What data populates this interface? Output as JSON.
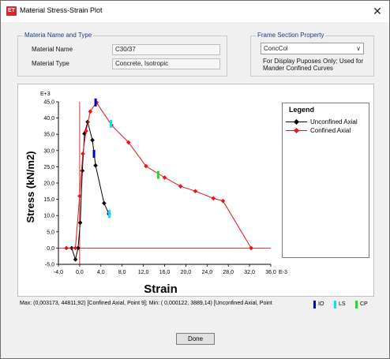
{
  "window": {
    "title": "Material Stress-Strain Plot",
    "icon_text": "ET",
    "close_glyph": "✕"
  },
  "material": {
    "group_title": "Materia Name and Type",
    "name_label": "Material Name",
    "name_value": "C30/37",
    "type_label": "Material Type",
    "type_value": "Concrete, Isotropic"
  },
  "frame_section": {
    "group_title": "Frame Section Property",
    "selected": "ConcCol",
    "note_line1": "For Display Puposes Only;  Used for",
    "note_line2": "Mander Confined Curves"
  },
  "legend": {
    "title": "Legend",
    "items": [
      "Unconfined Axial",
      "Confined Axial"
    ]
  },
  "status": {
    "text": "Max: (0,003173, 44811,92)  [Confined Axial, Point 9];  Min: ( 0,000122,  3889,14)  [Unconfined Axial, Point",
    "keys": [
      {
        "label": "IO",
        "color": "#0000cc"
      },
      {
        "label": "LS",
        "color": "#00e5ff"
      },
      {
        "label": "CP",
        "color": "#22dd22"
      }
    ]
  },
  "done_label": "Done",
  "chart_data": {
    "type": "line",
    "ylabel": "Stress (kN/m2)",
    "xlabel": "Strain",
    "y_multiplier": "E+3",
    "x_multiplier": "E-3",
    "xlim": [
      -4,
      36
    ],
    "ylim": [
      -5,
      45
    ],
    "x_ticks": [
      "-4,0",
      "0,0",
      "4,0",
      "8,0",
      "12,0",
      "16,0",
      "20,0",
      "24,0",
      "28,0",
      "32,0",
      "36,0"
    ],
    "y_ticks": [
      "-5,0",
      "0,0",
      "5,0",
      "10,0",
      "15,0",
      "20,0",
      "25,0",
      "30,0",
      "35,0",
      "40,0",
      "45,0"
    ],
    "colors": {
      "unconfined": "#000000",
      "confined": "#e8141a",
      "axis_vertical": "#cc0000",
      "axis_horizontal": "#cc0000"
    },
    "series": [
      {
        "name": "Unconfined Axial",
        "color": "#000000",
        "points": [
          [
            -1.5,
            0
          ],
          [
            -0.8,
            -3.5
          ],
          [
            -0.3,
            0
          ],
          [
            0.1,
            7.8
          ],
          [
            0.5,
            23.8
          ],
          [
            0.9,
            35.2
          ],
          [
            1.5,
            38.8
          ],
          [
            2.4,
            33.2
          ],
          [
            3.0,
            25.4
          ],
          [
            4.6,
            13.8
          ],
          [
            5.5,
            10.5
          ]
        ]
      },
      {
        "name": "Confined Axial",
        "color": "#e8141a",
        "points": [
          [
            -2.5,
            0
          ],
          [
            -0.8,
            0
          ],
          [
            0.0,
            16.0
          ],
          [
            0.6,
            29.0
          ],
          [
            1.2,
            36.0
          ],
          [
            2.0,
            42.0
          ],
          [
            3.17,
            44.8
          ],
          [
            6.0,
            37.8
          ],
          [
            9.2,
            32.5
          ],
          [
            12.5,
            25.2
          ],
          [
            16.0,
            21.7
          ],
          [
            19.0,
            19.0
          ],
          [
            21.8,
            17.5
          ],
          [
            25.2,
            15.3
          ],
          [
            27.0,
            14.5
          ],
          [
            32.3,
            0
          ]
        ]
      }
    ],
    "markers": [
      {
        "kind": "IO",
        "color": "#0000cc",
        "x": 3.0,
        "y": 44.8
      },
      {
        "kind": "IO",
        "color": "#0000cc",
        "x": 2.7,
        "y": 29.0
      },
      {
        "kind": "LS",
        "color": "#00e5ff",
        "x": 5.9,
        "y": 38.2
      },
      {
        "kind": "LS",
        "color": "#00e5ff",
        "x": 5.6,
        "y": 10.5
      },
      {
        "kind": "CP",
        "color": "#22dd22",
        "x": 14.8,
        "y": 22.5
      }
    ]
  }
}
